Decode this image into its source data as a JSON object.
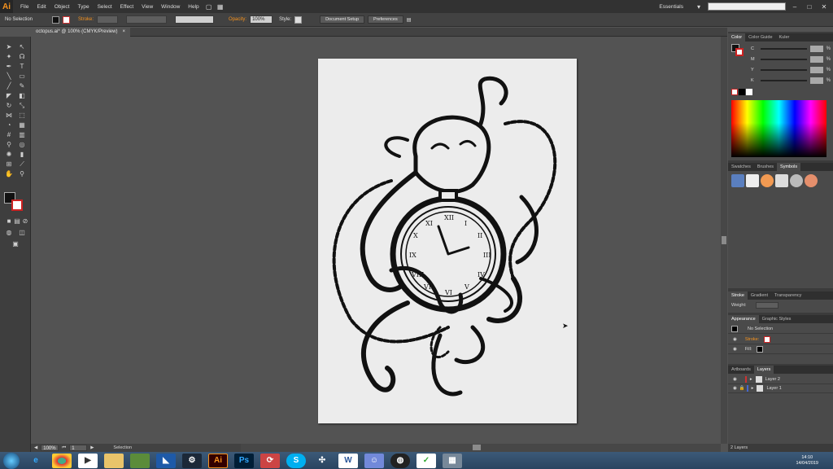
{
  "app": {
    "logo": "Ai",
    "workspace": "Essentials",
    "search_placeholder": ""
  },
  "menu": [
    "File",
    "Edit",
    "Object",
    "Type",
    "Select",
    "Effect",
    "View",
    "Window",
    "Help"
  ],
  "control": {
    "selection_label": "No Selection",
    "stroke_label": "Stroke:",
    "opacity_label": "Opacity:",
    "opacity_value": "100%",
    "style_label": "Style:",
    "document_setup": "Document Setup",
    "preferences": "Preferences"
  },
  "document": {
    "tab_title": "octopus.ai* @ 100% (CMYK/Preview)",
    "close": "×"
  },
  "status": {
    "zoom": "100%",
    "artboard": "1",
    "tool": "Selection"
  },
  "panels": {
    "color": {
      "tabs": [
        "Color",
        "Color Guide",
        "Kuler"
      ],
      "channels": [
        "C",
        "M",
        "Y",
        "K"
      ],
      "unit": "%"
    },
    "swatches": {
      "tabs": [
        "Swatches",
        "Brushes",
        "Symbols"
      ]
    },
    "stroke": {
      "tabs": [
        "Stroke",
        "Gradient",
        "Transparency"
      ],
      "weight_label": "Weight:"
    },
    "appearance": {
      "tabs": [
        "Appearance",
        "Graphic Styles"
      ],
      "title": "No Selection",
      "stroke_label": "Stroke:",
      "fill_label": "Fill:"
    },
    "layers": {
      "tabs": [
        "Artboards",
        "Layers"
      ],
      "items": [
        "Layer 2",
        "Layer 1"
      ],
      "count": "2 Layers"
    }
  },
  "taskbar": {
    "time": "14:10",
    "date": "14/04/2019",
    "apps": [
      "Ai",
      "Ps",
      "W"
    ]
  },
  "colors": {
    "accent": "#f7931e",
    "panel_bg": "#4a4a4a",
    "canvas_bg": "#535353",
    "artboard": "#ececec"
  }
}
